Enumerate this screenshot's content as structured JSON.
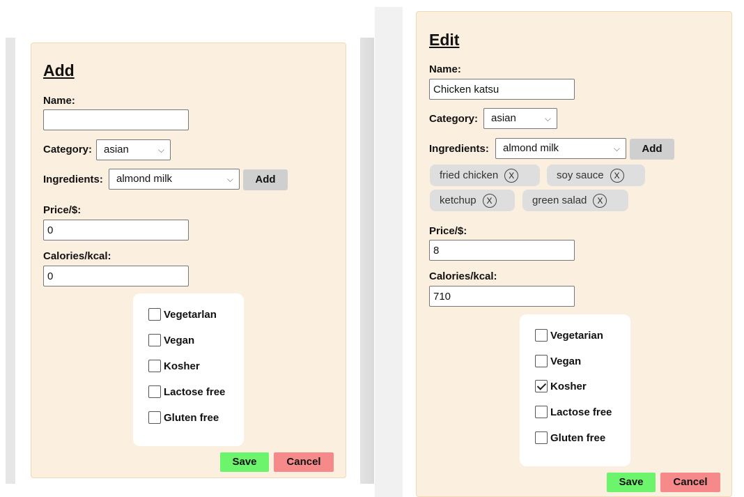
{
  "add_form": {
    "title": "Add",
    "name_label": "Name:",
    "name_value": "",
    "category_label": "Category:",
    "category_value": "asian",
    "ingredients_label": "Ingredients:",
    "ingredients_value": "almond milk",
    "add_button": "Add",
    "price_label": "Price/$:",
    "price_value": "0",
    "calories_label": "Calories/kcal:",
    "calories_value": "0",
    "checkboxes": [
      {
        "label": "Vegetarlan",
        "checked": false
      },
      {
        "label": "Vegan",
        "checked": false
      },
      {
        "label": "Kosher",
        "checked": false
      },
      {
        "label": "Lactose free",
        "checked": false
      },
      {
        "label": "Gluten free",
        "checked": false
      }
    ],
    "save_button": "Save",
    "cancel_button": "Cancel"
  },
  "edit_form": {
    "title": "Edit",
    "name_label": "Name:",
    "name_value": "Chicken katsu",
    "category_label": "Category:",
    "category_value": "asian",
    "ingredients_label": "Ingredients:",
    "ingredients_value": "almond milk",
    "add_button": "Add",
    "ingredient_chips": [
      {
        "label": "fried chicken",
        "remove": "X"
      },
      {
        "label": "soy sauce",
        "remove": "X"
      },
      {
        "label": "ketchup",
        "remove": "X"
      },
      {
        "label": "green salad",
        "remove": "X"
      }
    ],
    "price_label": "Price/$:",
    "price_value": "8",
    "calories_label": "Calories/kcal:",
    "calories_value": "710",
    "checkboxes": [
      {
        "label": "Vegetarian",
        "checked": false
      },
      {
        "label": "Vegan",
        "checked": false
      },
      {
        "label": "Kosher",
        "checked": true
      },
      {
        "label": "Lactose free",
        "checked": false
      },
      {
        "label": "Gluten free",
        "checked": false
      }
    ],
    "save_button": "Save",
    "cancel_button": "Cancel"
  },
  "colors": {
    "panel_background": "#fbefe0",
    "save_button": "#6cf46c",
    "cancel_button": "#f68a8a",
    "add_button": "#cfcfcf",
    "chip": "#dedede"
  },
  "icons": {
    "select_arrow": "chevron-down-icon",
    "chip_remove": "close-circle-icon",
    "checkbox_mark": "checkmark-icon"
  }
}
